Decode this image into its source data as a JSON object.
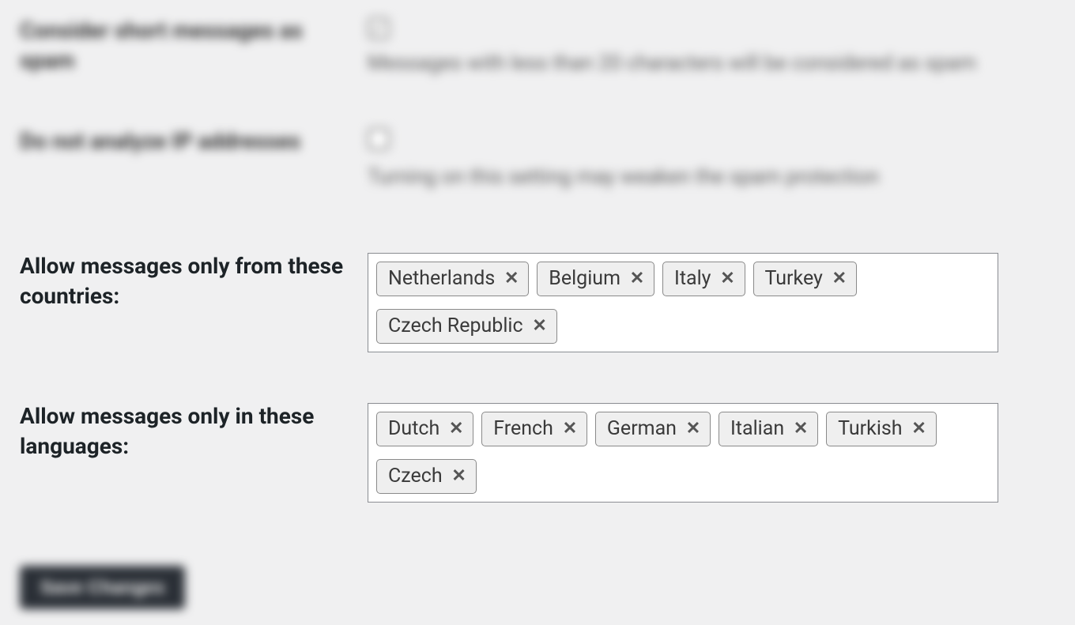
{
  "settings": {
    "short_messages": {
      "label": "Consider short messages as spam",
      "checked": true,
      "description": "Messages with less than 20 characters will be considered as spam"
    },
    "no_ip": {
      "label": "Do not analyze IP addresses",
      "checked": false,
      "description": "Turning on this setting may weaken the spam protection"
    },
    "countries": {
      "label": "Allow messages only from these countries:",
      "tags": [
        "Netherlands",
        "Belgium",
        "Italy",
        "Turkey",
        "Czech Republic"
      ]
    },
    "languages": {
      "label": "Allow messages only in these languages:",
      "tags": [
        "Dutch",
        "French",
        "German",
        "Italian",
        "Turkish",
        "Czech"
      ]
    }
  },
  "buttons": {
    "save": "Save Changes"
  }
}
